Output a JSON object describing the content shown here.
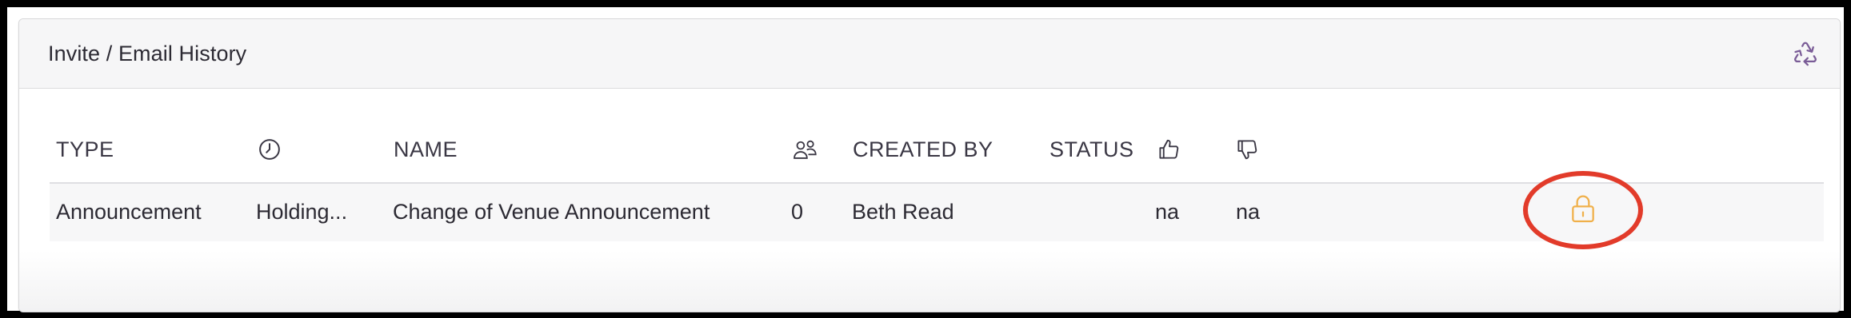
{
  "panel": {
    "title": "Invite / Email History",
    "refresh_icon": "recycle-icon",
    "accent_color": "#7a5c97"
  },
  "table": {
    "columns": [
      {
        "label": "TYPE"
      },
      {
        "icon": "clock-icon"
      },
      {
        "label": "NAME"
      },
      {
        "icon": "people-icon"
      },
      {
        "label": "CREATED BY"
      },
      {
        "label": "STATUS"
      },
      {
        "icon": "thumbs-up-icon"
      },
      {
        "icon": "thumbs-down-icon"
      }
    ],
    "rows": [
      {
        "type": "Announcement",
        "time": "Holding...",
        "name": "Change of Venue Announcement",
        "recipients": "0",
        "created_by": "Beth Read",
        "status_icon": "lock-icon",
        "likes": "na",
        "dislikes": "na"
      }
    ]
  },
  "colors": {
    "lock": "#f0b04a",
    "highlight_circle": "#e23b2a"
  }
}
